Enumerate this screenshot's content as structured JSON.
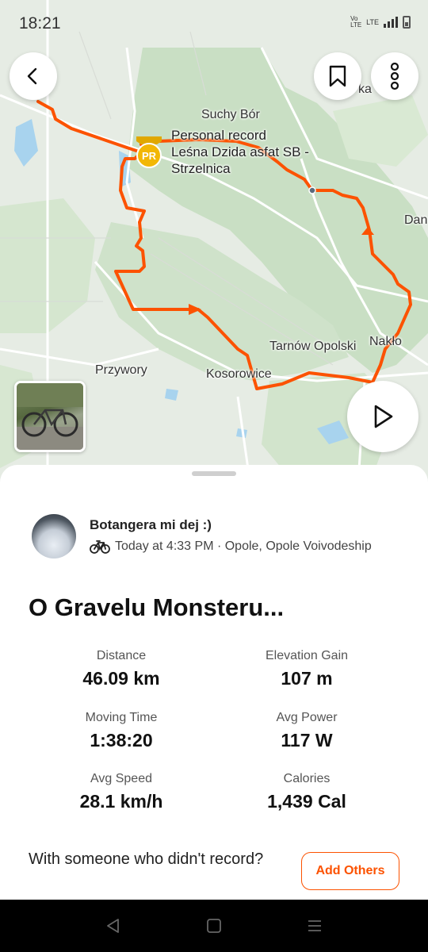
{
  "status_bar": {
    "time": "18:21",
    "network_1": "Vo LTE",
    "network_2": "LTE",
    "icons": [
      "signal-icon",
      "battery-icon"
    ]
  },
  "map": {
    "labels": {
      "suchy_bor": "Suchy Bór",
      "tarnow": "Tarnów Opolski",
      "naklo": "Nakło",
      "przywory": "Przywory",
      "kosorowice": "Kosorowice",
      "dan": "Dan",
      "top_right": "ka"
    },
    "pr_badge_text": "PR",
    "personal_record": {
      "title": "Personal record",
      "segment_line1": "Leśna Dzida asfat SB -",
      "segment_line2": "Strzelnica"
    },
    "route_color": "#fc5200"
  },
  "buttons": {
    "back_icon": "chevron-left-icon",
    "bookmark_icon": "bookmark-icon",
    "more_icon": "more-vertical-icon",
    "play_icon": "play-icon"
  },
  "activity": {
    "athlete_name": "Botangera mi dej :)",
    "sport_icon": "bike-icon",
    "meta": "Today at 4:33 PM · Opole, Opole Voivodeship",
    "title": "O Gravelu Monsteru...",
    "stats": [
      {
        "label": "Distance",
        "value": "46.09 km"
      },
      {
        "label": "Elevation Gain",
        "value": "107 m"
      },
      {
        "label": "Moving Time",
        "value": "1:38:20"
      },
      {
        "label": "Avg Power",
        "value": "117 W"
      },
      {
        "label": "Avg Speed",
        "value": "28.1 km/h"
      },
      {
        "label": "Calories",
        "value": "1,439 Cal"
      }
    ],
    "record_question": "With someone who didn't record?",
    "add_others_label": "Add Others",
    "accent": "#fc5200"
  },
  "navbar": {
    "icons": [
      "back-triangle-icon",
      "home-square-icon",
      "menu-lines-icon"
    ]
  }
}
